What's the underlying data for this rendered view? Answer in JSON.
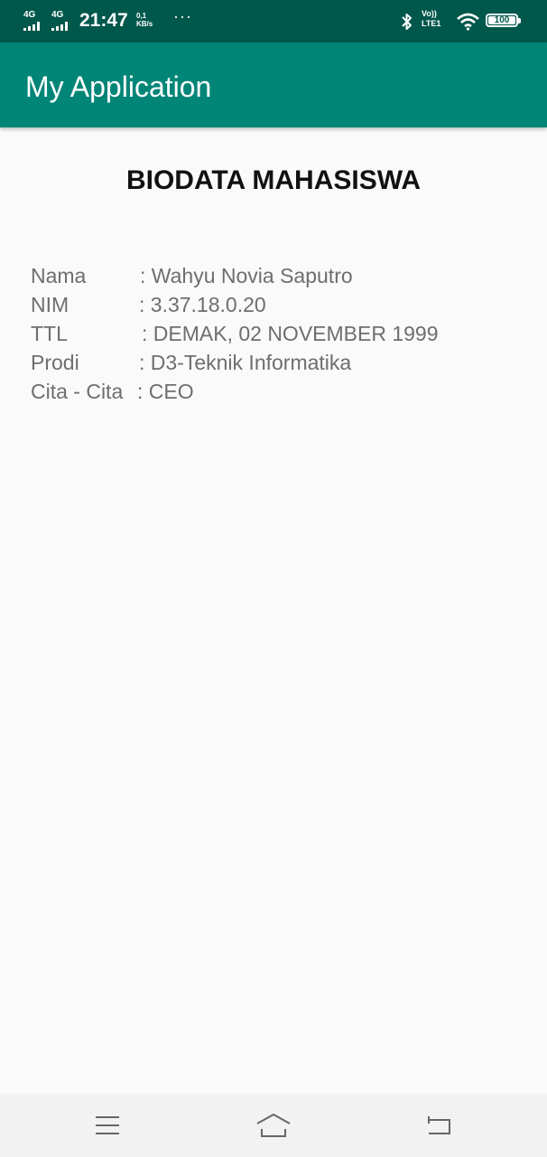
{
  "status_bar": {
    "sim1_network": "4G",
    "sim2_network": "4G",
    "time": "21:47",
    "speed_value": "0,1",
    "speed_unit": "KB/s",
    "overflow": "···",
    "volte_top": "Vo))",
    "volte_bottom": "LTE1",
    "battery_level": "100",
    "icons": [
      "signal-icon",
      "signal-icon",
      "bluetooth-icon",
      "wifi-icon",
      "battery-icon"
    ]
  },
  "app_bar": {
    "title": "My Application",
    "color": "#008577"
  },
  "main": {
    "heading": "BIODATA MAHASISWA",
    "fields": [
      {
        "label": "Nama",
        "value": ": Wahyu Novia Saputro"
      },
      {
        "label": "NIM",
        "value": ": 3.37.18.0.20"
      },
      {
        "label": "TTL",
        "value": ": DEMAK, 02 NOVEMBER 1999"
      },
      {
        "label": "Prodi",
        "value": ": D3-Teknik Informatika"
      },
      {
        "label": "Cita - Cita",
        "value": ": CEO"
      }
    ]
  },
  "nav_bar": {
    "buttons": [
      "menu-icon",
      "home-icon",
      "back-icon"
    ]
  }
}
